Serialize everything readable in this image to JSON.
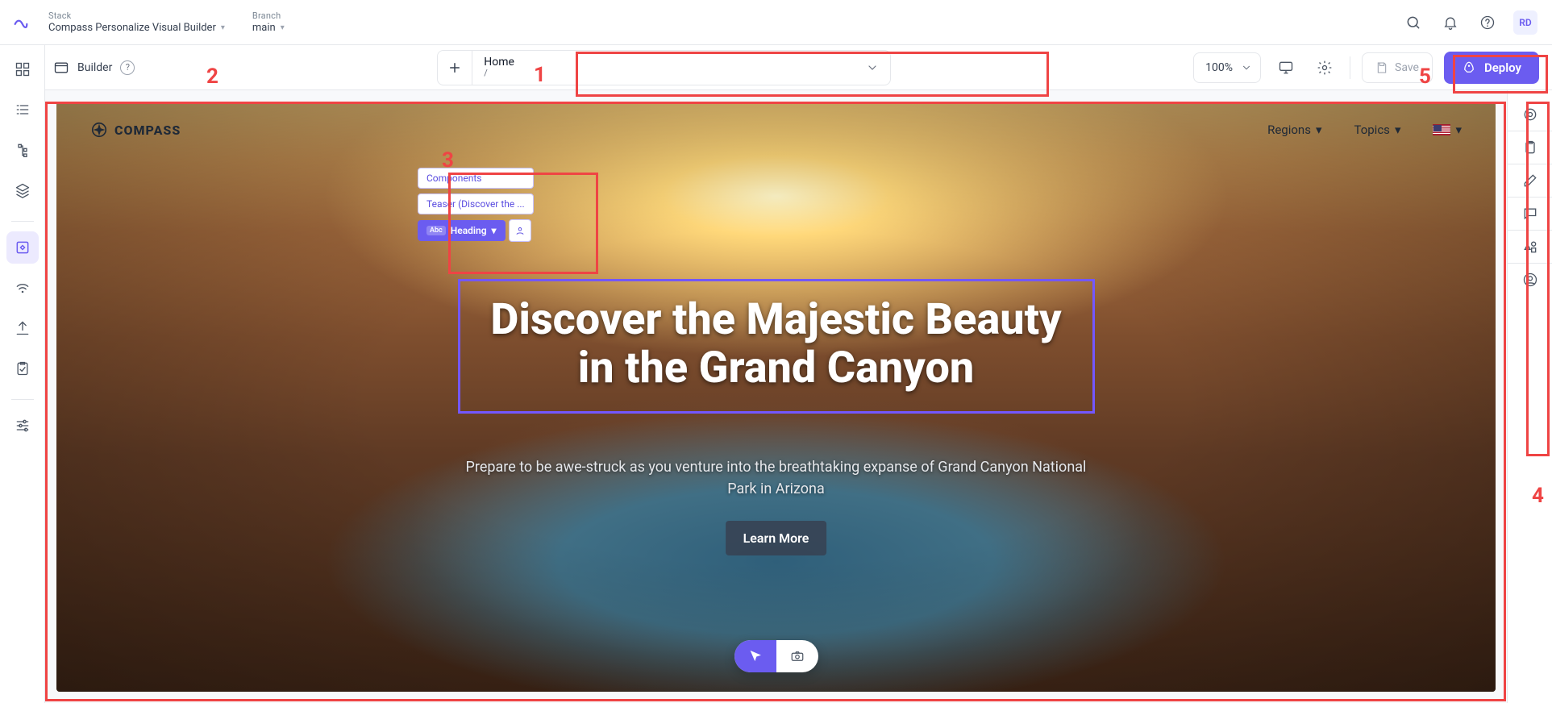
{
  "header": {
    "stack_label": "Stack",
    "stack_value": "Compass Personalize Visual Builder",
    "branch_label": "Branch",
    "branch_value": "main",
    "avatar": "RD"
  },
  "toolbar": {
    "builder_label": "Builder",
    "page_title": "Home",
    "page_path": "/",
    "zoom": "100%",
    "save_label": "Save",
    "deploy_label": "Deploy"
  },
  "canvas": {
    "brand": "COMPASS",
    "nav": {
      "regions": "Regions",
      "topics": "Topics"
    },
    "crumbs": {
      "components": "Components",
      "teaser": "Teaser (Discover the ...",
      "heading_tag": "Abc",
      "heading": "Heading"
    },
    "hero_title": "Discover the Majestic Beauty in the Grand Canyon",
    "hero_sub": "Prepare to be awe-struck as you venture into the breathtaking expanse of Grand Canyon National Park in Arizona",
    "hero_cta": "Learn More"
  },
  "annot": {
    "n1": "1",
    "n2": "2",
    "n3": "3",
    "n4": "4",
    "n5": "5"
  }
}
